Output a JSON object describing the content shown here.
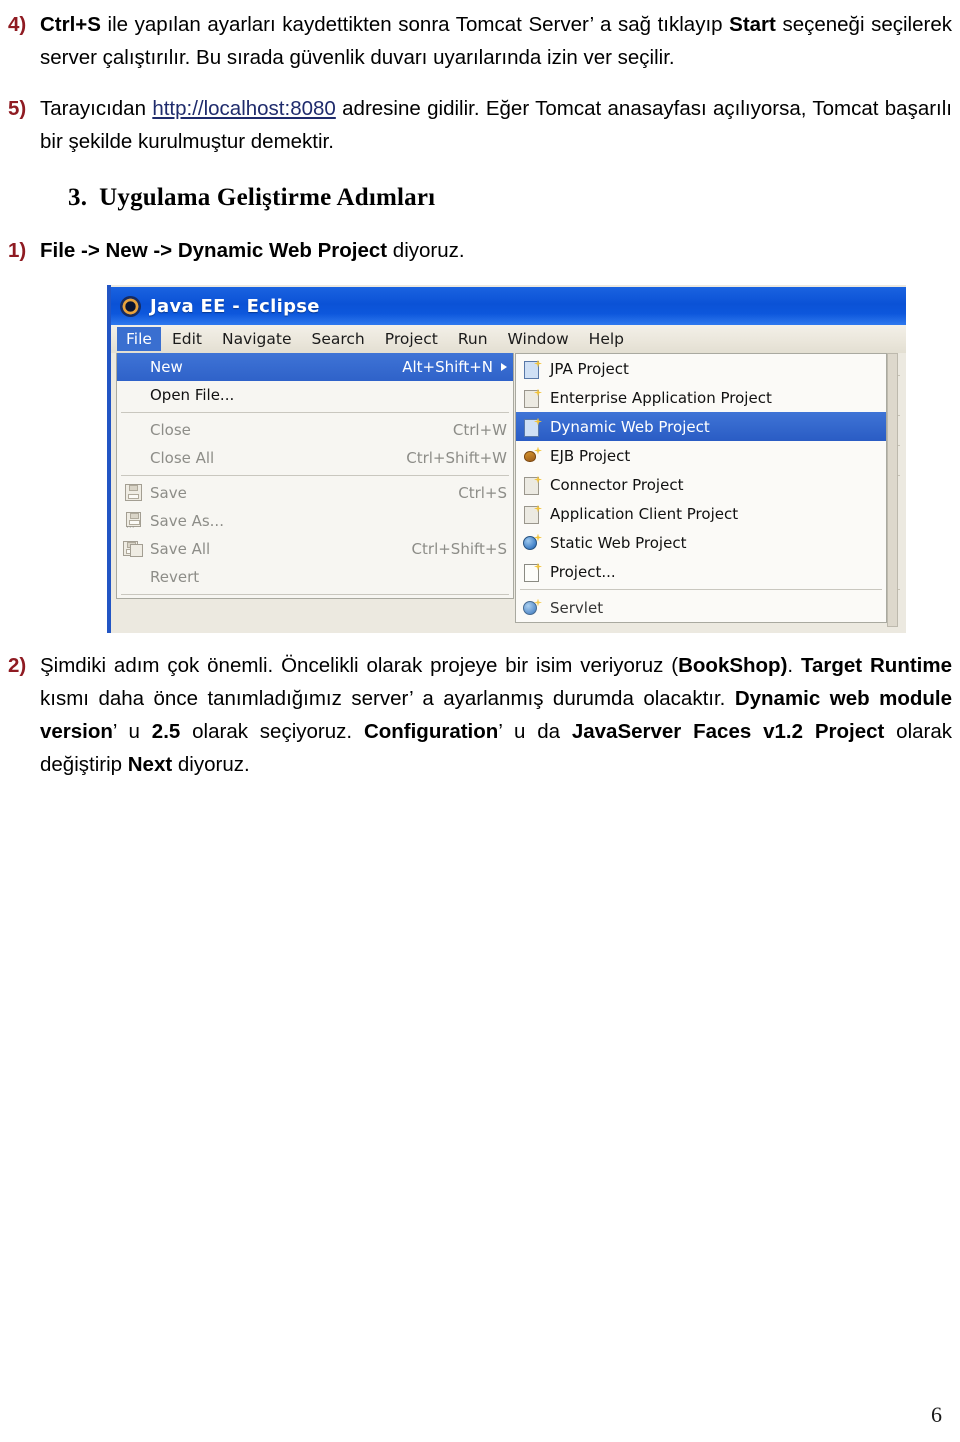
{
  "document": {
    "page_number": "6",
    "accent_number_color": "#8f1b22",
    "link_color": "#1f2b6c"
  },
  "items": [
    {
      "number": "4)",
      "segments": [
        {
          "text": "Ctrl+S",
          "style": "bold"
        },
        {
          "text": " ile yapılan ayarları kaydettikten sonra Tomcat Server’ a sağ tıklayıp ",
          "style": "normal"
        },
        {
          "text": "Start",
          "style": "bold"
        },
        {
          "text": " seçeneği seçilerek server çalıştırılır. Bu sırada güvenlik duvarı uyarılarında izin ver seçilir.",
          "style": "normal"
        }
      ]
    },
    {
      "number": "5)",
      "segments": [
        {
          "text": "Tarayıcıdan ",
          "style": "normal"
        },
        {
          "text": "http://localhost:8080",
          "style": "link"
        },
        {
          "text": " adresine gidilir. Eğer Tomcat anasayfası açılıyorsa, Tomcat başarılı bir şekilde kurulmuştur demektir.",
          "style": "normal"
        }
      ]
    }
  ],
  "section": {
    "number": "3.",
    "title": "Uygulama Geliştirme Adımları"
  },
  "step1": {
    "number": "1)",
    "segments": [
      {
        "text": "File -> New -> Dynamic Web Project",
        "style": "bold"
      },
      {
        "text": " diyoruz.",
        "style": "normal"
      }
    ]
  },
  "step2": {
    "number": "2)",
    "segments": [
      {
        "text": "Şimdiki adım çok önemli. Öncelikli olarak projeye bir isim veriyoruz (",
        "style": "normal"
      },
      {
        "text": "BookShop)",
        "style": "bold"
      },
      {
        "text": ". ",
        "style": "normal"
      },
      {
        "text": "Target Runtime",
        "style": "bold"
      },
      {
        "text": " kısmı daha önce tanımladığımız server’ a ayarlanmış durumda olacaktır. ",
        "style": "normal"
      },
      {
        "text": "Dynamic web module version",
        "style": "bold"
      },
      {
        "text": "’ u ",
        "style": "normal"
      },
      {
        "text": "2.5",
        "style": "bold"
      },
      {
        "text": " olarak seçiyoruz. ",
        "style": "normal"
      },
      {
        "text": "Configuration",
        "style": "bold"
      },
      {
        "text": "’ u da ",
        "style": "normal"
      },
      {
        "text": "JavaServer Faces v1.2 Project",
        "style": "bold"
      },
      {
        "text": " olarak değiştirip ",
        "style": "normal"
      },
      {
        "text": "Next",
        "style": "bold"
      },
      {
        "text": " diyoruz.",
        "style": "normal"
      }
    ]
  },
  "screenshot": {
    "title": "Java EE - Eclipse",
    "title_icon": "eclipse-gear-icon",
    "titlebar_color": "#0d57dc",
    "menubar": [
      {
        "label": "File",
        "active": true
      },
      {
        "label": "Edit",
        "active": false
      },
      {
        "label": "Navigate",
        "active": false
      },
      {
        "label": "Search",
        "active": false
      },
      {
        "label": "Project",
        "active": false
      },
      {
        "label": "Run",
        "active": false
      },
      {
        "label": "Window",
        "active": false
      },
      {
        "label": "Help",
        "active": false
      }
    ],
    "file_menu": [
      {
        "label": "New",
        "accel": "Alt+Shift+N",
        "state": "selected",
        "submenu_arrow": true,
        "icon": ""
      },
      {
        "label": "Open File...",
        "accel": "",
        "state": "enabled",
        "submenu_arrow": false,
        "icon": ""
      },
      {
        "separator": true
      },
      {
        "label": "Close",
        "accel": "Ctrl+W",
        "state": "disabled",
        "submenu_arrow": false,
        "icon": ""
      },
      {
        "label": "Close All",
        "accel": "Ctrl+Shift+W",
        "state": "disabled",
        "submenu_arrow": false,
        "icon": ""
      },
      {
        "separator": true
      },
      {
        "label": "Save",
        "accel": "Ctrl+S",
        "state": "disabled",
        "submenu_arrow": false,
        "icon": "floppy-save-icon"
      },
      {
        "label": "Save As...",
        "accel": "",
        "state": "disabled",
        "submenu_arrow": false,
        "icon": "floppy-save-as-icon"
      },
      {
        "label": "Save All",
        "accel": "Ctrl+Shift+S",
        "state": "disabled",
        "submenu_arrow": false,
        "icon": "floppy-save-all-icon"
      },
      {
        "label": "Revert",
        "accel": "",
        "state": "disabled",
        "submenu_arrow": false,
        "icon": ""
      },
      {
        "separator": true
      }
    ],
    "new_submenu": [
      {
        "label": "JPA Project",
        "icon": "jpa-project-icon",
        "selected": false
      },
      {
        "label": "Enterprise Application Project",
        "icon": "enterprise-application-project-icon",
        "selected": false
      },
      {
        "label": "Dynamic Web Project",
        "icon": "dynamic-web-project-icon",
        "selected": true
      },
      {
        "label": "EJB Project",
        "icon": "ejb-project-icon",
        "selected": false
      },
      {
        "label": "Connector Project",
        "icon": "connector-project-icon",
        "selected": false
      },
      {
        "label": "Application Client Project",
        "icon": "application-client-project-icon",
        "selected": false
      },
      {
        "label": "Static Web Project",
        "icon": "static-web-project-icon",
        "selected": false
      },
      {
        "label": "Project...",
        "icon": "project-icon",
        "selected": false
      },
      {
        "separator": true
      },
      {
        "label": "Servlet",
        "icon": "servlet-icon",
        "selected": false,
        "clipped": true
      }
    ]
  }
}
